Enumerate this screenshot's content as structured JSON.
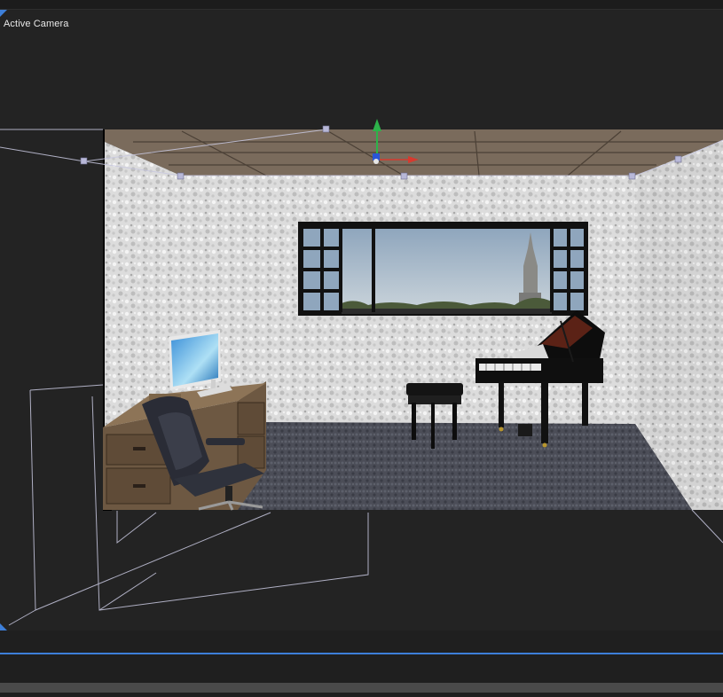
{
  "viewport": {
    "label": "Active Camera"
  },
  "colors": {
    "background": "#232323",
    "accent": "#3d7fd9",
    "gizmo_x": "#d63a2f",
    "gizmo_y": "#2db34a",
    "gizmo_z": "#2a55d6"
  },
  "icons": {
    "transform_gizmo": "move-gizmo-icon"
  }
}
